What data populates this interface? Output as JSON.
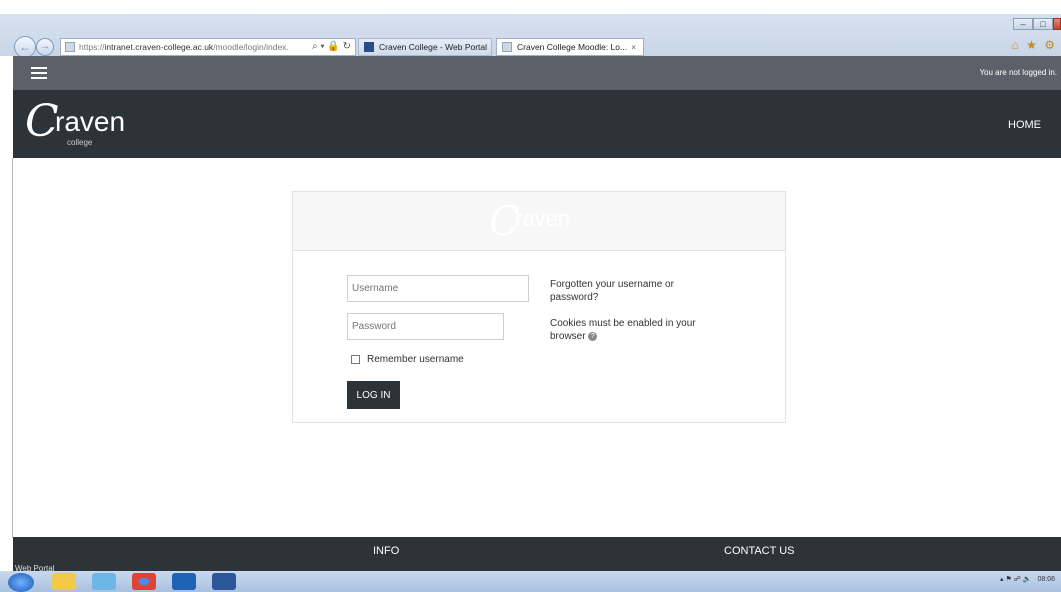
{
  "browser": {
    "address": {
      "url_prefix": "https://",
      "url_host": "intranet.craven-college.ac.uk",
      "url_path": "/moodle/login/index.",
      "tools": "⌕ ▾ 🔒 ↻"
    },
    "tabs": [
      {
        "label": "Craven College - Web Portal"
      },
      {
        "label": "Craven College Moodle: Lo...",
        "close": "×"
      }
    ],
    "window_buttons": {
      "minimize": "–",
      "maximize": "□"
    },
    "right_icons": "⌂ ★ ⚙"
  },
  "topbar": {
    "login_status": "You are not logged in."
  },
  "header": {
    "logo": {
      "initial": "C",
      "word": "raven",
      "sub": "college"
    },
    "home": "HOME"
  },
  "login": {
    "logo": {
      "initial": "C",
      "word": "raven"
    },
    "username_placeholder": "Username",
    "password_placeholder": "Password",
    "remember_label": "Remember username",
    "button": "LOG IN",
    "forgotten": "Forgotten your username or password?",
    "cookies": "Cookies must be enabled in your browser",
    "help_icon": "?"
  },
  "footer": {
    "info": "INFO",
    "contact": "CONTACT US",
    "cut_text": "Web Portal"
  },
  "taskbar": {
    "tray_time": "08:06"
  },
  "colors": {
    "topbar": "#5b6168",
    "header": "#2c3339",
    "button": "#2c3339"
  }
}
